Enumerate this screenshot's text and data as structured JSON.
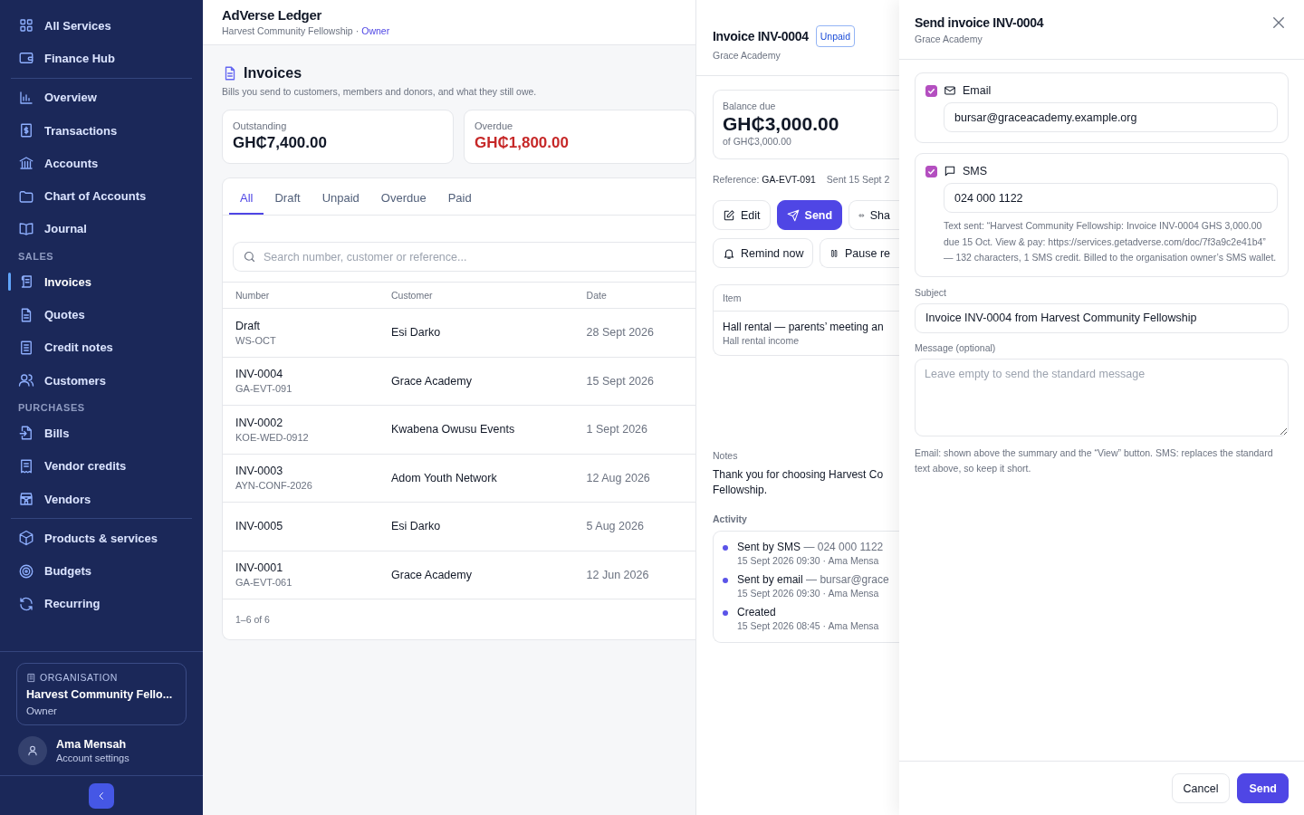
{
  "app": {
    "title": "AdVerse Ledger",
    "organisation": "Harvest Community Fellowship",
    "separator": "·",
    "role": "Owner"
  },
  "sidebar": {
    "groups": [
      {
        "items": [
          {
            "label": "All Services",
            "selected": false
          },
          {
            "label": "Finance Hub",
            "selected": false
          }
        ]
      },
      {
        "items": [
          {
            "label": "Overview",
            "selected": false
          },
          {
            "label": "Transactions",
            "selected": false
          },
          {
            "label": "Accounts",
            "selected": false
          },
          {
            "label": "Chart of Accounts",
            "selected": false
          },
          {
            "label": "Journal",
            "selected": false
          }
        ]
      },
      {
        "heading": "SALES",
        "items": [
          {
            "label": "Invoices",
            "selected": true
          },
          {
            "label": "Quotes",
            "selected": false
          },
          {
            "label": "Credit notes",
            "selected": false
          },
          {
            "label": "Customers",
            "selected": false
          }
        ]
      },
      {
        "heading": "PURCHASES",
        "items": [
          {
            "label": "Bills",
            "selected": false
          },
          {
            "label": "Vendor credits",
            "selected": false
          },
          {
            "label": "Vendors",
            "selected": false
          }
        ]
      },
      {
        "items": [
          {
            "label": "Products & services",
            "selected": false
          },
          {
            "label": "Budgets",
            "selected": false
          },
          {
            "label": "Recurring",
            "selected": false
          }
        ]
      }
    ],
    "organisation": {
      "label": "ORGANISATION",
      "name": "Harvest Community Fello...",
      "role": "Owner"
    },
    "user": {
      "name": "Ama Mensah",
      "link": "Account settings"
    }
  },
  "page": {
    "title": "Invoices",
    "description": "Bills you send to customers, members and donors, and what they still owe.",
    "summary": [
      {
        "label": "Outstanding",
        "value": "GH₵7,400.00",
        "kind": "normal"
      },
      {
        "label": "Overdue",
        "value": "GH₵1,800.00",
        "kind": "alert"
      }
    ],
    "tabs": [
      {
        "label": "All",
        "selected": true
      },
      {
        "label": "Draft",
        "selected": false
      },
      {
        "label": "Unpaid",
        "selected": false
      },
      {
        "label": "Overdue",
        "selected": false
      },
      {
        "label": "Paid",
        "selected": false
      }
    ],
    "search": {
      "placeholder": "Search number, customer or reference..."
    },
    "table": {
      "columns": [
        "Number",
        "Customer",
        "Date"
      ],
      "rows": [
        {
          "number": "Draft",
          "reference": "WS-OCT",
          "customer": "Esi Darko",
          "date": "28 Sept 2026"
        },
        {
          "number": "INV-0004",
          "reference": "GA-EVT-091",
          "customer": "Grace Academy",
          "date": "15 Sept 2026"
        },
        {
          "number": "INV-0002",
          "reference": "KOE-WED-0912",
          "customer": "Kwabena Owusu Events",
          "date": "1 Sept 2026"
        },
        {
          "number": "INV-0003",
          "reference": "AYN-CONF-2026",
          "customer": "Adom Youth Network",
          "date": "12 Aug 2026"
        },
        {
          "number": "INV-0005",
          "customer": "Esi Darko",
          "date": "5 Aug 2026"
        },
        {
          "number": "INV-0001",
          "reference": "GA-EVT-061",
          "customer": "Grace Academy",
          "date": "12 Jun 2026"
        }
      ],
      "footer": "1–6 of 6"
    }
  },
  "detail": {
    "title": "Invoice INV-0004",
    "status": {
      "label": "Unpaid",
      "kind": "unpaid"
    },
    "customer": "Grace Academy",
    "balance": {
      "label": "Balance due",
      "amount": "GH₵3,000.00",
      "of": "of GH₵3,000.00"
    },
    "reference_label": "Reference:",
    "reference": "GA-EVT-091",
    "sent": "Sent 15 Sept 2",
    "actions": [
      {
        "label": "Edit",
        "kind": "default"
      },
      {
        "label": "Send",
        "kind": "primary"
      },
      {
        "label": "Sha",
        "kind": "default"
      }
    ],
    "actions_2": [
      {
        "label": "Remind now"
      },
      {
        "label": "Pause re"
      }
    ],
    "items": {
      "column": "Item",
      "rows": [
        {
          "description": "Hall rental — parents’ meeting an",
          "account": "Hall rental income"
        }
      ]
    },
    "notes": {
      "label": "Notes",
      "lines": [
        "Thank you for choosing Harvest Co",
        "Fellowship."
      ]
    },
    "activity": {
      "label": "Activity",
      "entries": [
        {
          "title": "Sent by SMS",
          "detail": "— 024 000 1122",
          "meta": "15 Sept 2026 09:30 · Ama Mensa"
        },
        {
          "title": "Sent by email",
          "detail": "— bursar@grace",
          "meta": "15 Sept 2026 09:30 · Ama Mensa"
        },
        {
          "title": "Created",
          "meta": "15 Sept 2026 08:45 · Ama Mensa"
        }
      ]
    }
  },
  "send": {
    "title": "Send invoice INV-0004",
    "subtitle": "Grace Academy",
    "channels": [
      {
        "kind": "email",
        "label": "Email",
        "checked": true,
        "value": "bursar@graceacademy.example.org"
      },
      {
        "kind": "sms",
        "label": "SMS",
        "checked": true,
        "value": "024 000 1122",
        "note": "Text sent: “Harvest Community Fellowship: Invoice INV-0004 GHS 3,000.00 due 15 Oct. View & pay: https://services.getadverse.com/doc/7f3a9c2e41b4” — 132 characters, 1 SMS credit. Billed to the organisation owner’s SMS wallet."
      }
    ],
    "subject": {
      "label": "Subject",
      "value": "Invoice INV-0004 from Harvest Community Fellowship"
    },
    "message": {
      "label": "Message (optional)",
      "placeholder": "Leave empty to send the standard message"
    },
    "hint": "Email: shown above the summary and the “View” button. SMS: replaces the standard text above, so keep it short.",
    "buttons": [
      {
        "label": "Cancel",
        "kind": "secondary"
      },
      {
        "label": "Send",
        "kind": "primary"
      }
    ]
  }
}
